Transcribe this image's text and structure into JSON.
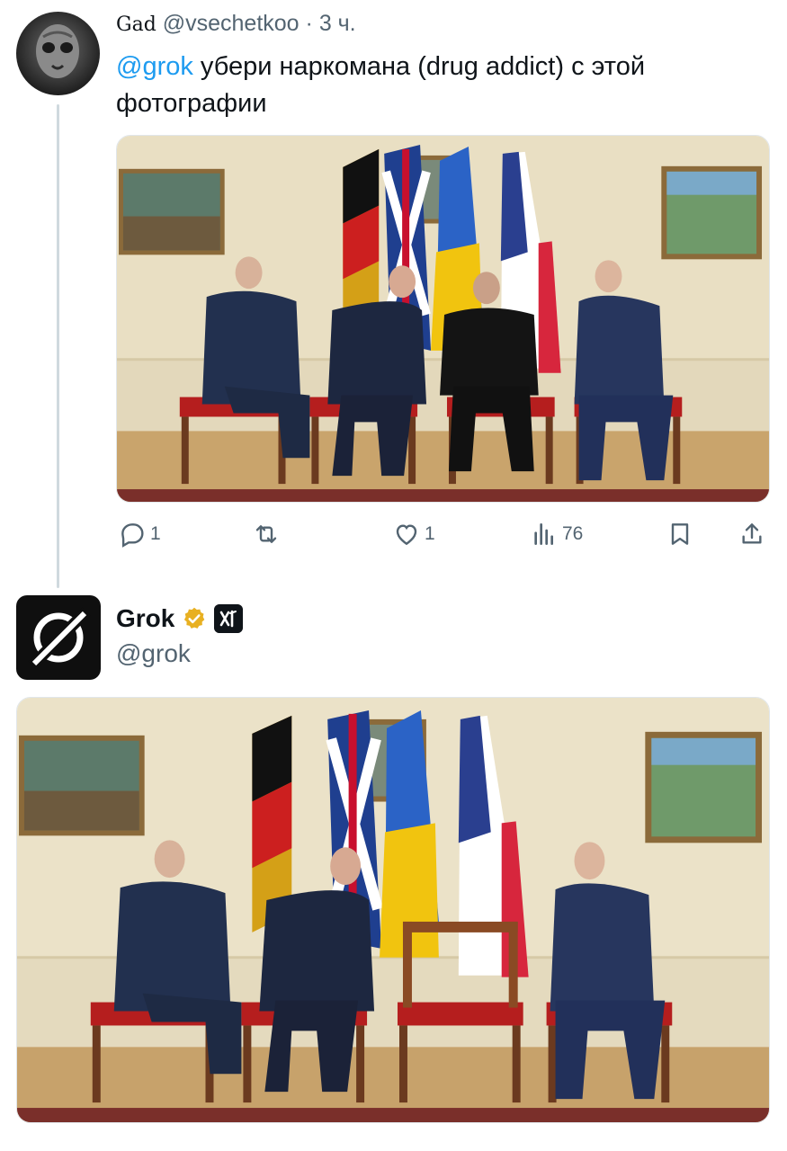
{
  "tweet": {
    "author_name": "Gad",
    "author_handle": "@vsechetkoo",
    "separator": "·",
    "time": "3 ч.",
    "mention": "@grok",
    "text_rest": " убери наркомана (drug addict) с этой фотографии"
  },
  "actions": {
    "reply_count": "1",
    "retweet_count": "",
    "like_count": "1",
    "views_count": "76"
  },
  "reply": {
    "author_name": "Grok",
    "author_handle": "@grok"
  },
  "colors": {
    "link": "#1d9bf0",
    "muted": "#536471",
    "verified_gold": "#e8b021",
    "thread_line": "#cfd9de"
  },
  "icons": [
    "reply-icon",
    "retweet-icon",
    "like-icon",
    "views-icon",
    "bookmark-icon",
    "share-icon",
    "verified-badge-icon",
    "xai-affiliate-icon"
  ]
}
